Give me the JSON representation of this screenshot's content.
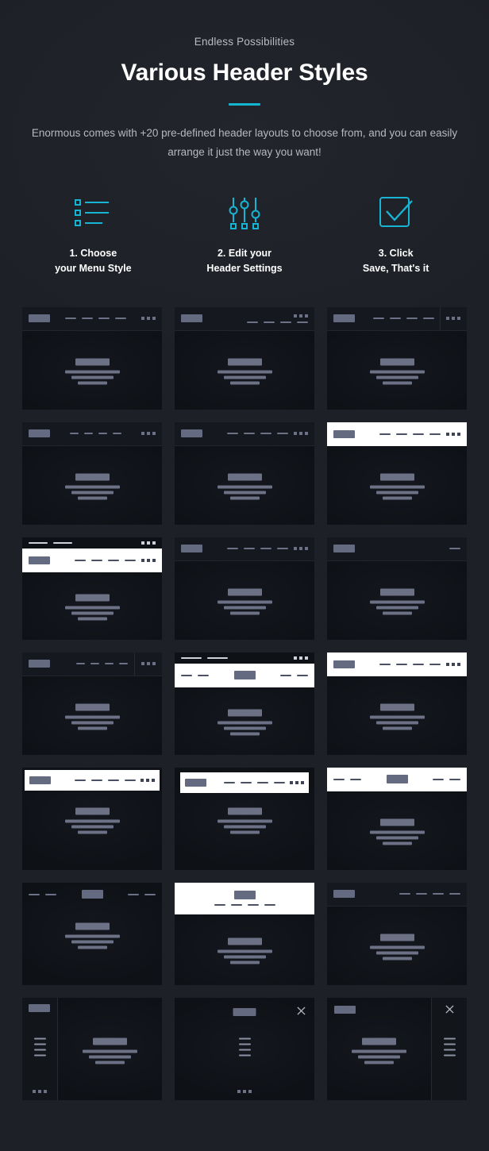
{
  "intro": {
    "eyebrow": "Endless Possibilities",
    "title": "Various Header Styles",
    "lede": "Enormous comes with +20 pre-defined header layouts to choose from, and you can easily arrange it just the way you want!",
    "accent_color": "#14b5d0"
  },
  "steps": [
    {
      "icon": "bullet-list-icon",
      "label": "1. Choose\nyour Menu Style"
    },
    {
      "icon": "sliders-icon",
      "label": "2. Edit your\nHeader Settings"
    },
    {
      "icon": "checkbox-check-icon",
      "label": "3. Click\nSave, That's it"
    }
  ],
  "palette": {
    "page_bg": "#1d2026",
    "thumb_body": "#0e1116",
    "thumb_header_dark": "#15181e",
    "thumb_header_light": "#ffffff",
    "placeholder": "#6c7186",
    "logo_block": "#646a80",
    "accent": "#14b5d0"
  },
  "grid": {
    "columns": 3,
    "count": 21,
    "thumbnails": [
      {
        "id": 1,
        "name": "dark-header-logo-left-menu-center-icons-right"
      },
      {
        "id": 2,
        "name": "dark-header-logo-left-menu-right-icons-above"
      },
      {
        "id": 3,
        "name": "dark-header-logo-left-menu-right-divider-icons"
      },
      {
        "id": 4,
        "name": "dark-header-compact-logo-left-menu-center"
      },
      {
        "id": 5,
        "name": "dark-header-logo-left-menu-right-tight"
      },
      {
        "id": 6,
        "name": "white-header-logo-left-menu-right-icons"
      },
      {
        "id": 7,
        "name": "two-tier-dark-topbar-white-main-header"
      },
      {
        "id": 8,
        "name": "dark-header-logo-left-menu-right-icons"
      },
      {
        "id": 9,
        "name": "dark-header-logo-left-single-item-right"
      },
      {
        "id": 10,
        "name": "dark-header-menu-center-icons-boxed-right"
      },
      {
        "id": 11,
        "name": "two-tier-white-header-centered-logo-split-menu"
      },
      {
        "id": 12,
        "name": "white-header-logo-left-menu-right-icons"
      },
      {
        "id": 13,
        "name": "white-floating-header-logo-left-menu-right"
      },
      {
        "id": 14,
        "name": "white-inset-header-logo-left-menu-right"
      },
      {
        "id": 15,
        "name": "white-header-centered-logo-split-menu"
      },
      {
        "id": 16,
        "name": "transparent-header-centered-logo-split-menu"
      },
      {
        "id": 17,
        "name": "white-tall-header-stacked-centered-logo-menu"
      },
      {
        "id": 18,
        "name": "dark-header-logo-left-menu-right-no-icons"
      },
      {
        "id": 19,
        "name": "left-sidebar-vertical-nav-layout"
      },
      {
        "id": 20,
        "name": "fullscreen-overlay-menu-with-close"
      },
      {
        "id": 21,
        "name": "right-drawer-menu-with-close"
      }
    ]
  }
}
